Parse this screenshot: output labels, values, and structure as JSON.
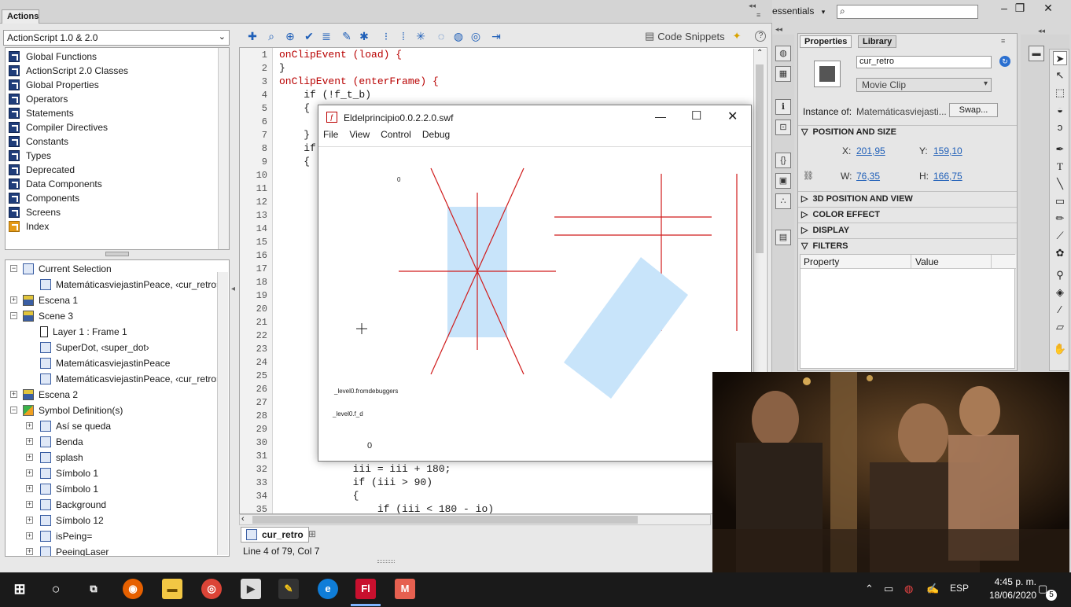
{
  "actions_panel": {
    "tab_label": "Actions",
    "language_select": "ActionScript 1.0 & 2.0",
    "library_items": [
      "Global Functions",
      "ActionScript 2.0 Classes",
      "Global Properties",
      "Operators",
      "Statements",
      "Compiler Directives",
      "Constants",
      "Types",
      "Deprecated",
      "Data Components",
      "Components",
      "Screens",
      "Index"
    ],
    "tree": [
      {
        "label": "Current Selection",
        "level": 0,
        "expander": "−",
        "icon": "script-icon"
      },
      {
        "label": "MatemáticasviejastinPeace, ‹cur_retro›",
        "level": 1,
        "expander": "",
        "icon": "movieclip-icon"
      },
      {
        "label": "Escena 1",
        "level": 0,
        "expander": "+",
        "icon": "scene-icon"
      },
      {
        "label": "Scene 3",
        "level": 0,
        "expander": "−",
        "icon": "scene-icon"
      },
      {
        "label": "Layer 1 : Frame 1",
        "level": 1,
        "expander": "",
        "icon": "frame-icon"
      },
      {
        "label": "SuperDot, ‹super_dot›",
        "level": 1,
        "expander": "",
        "icon": "movieclip-icon"
      },
      {
        "label": "MatemáticasviejastinPeace",
        "level": 1,
        "expander": "",
        "icon": "movieclip-icon"
      },
      {
        "label": "MatemáticasviejastinPeace, ‹cur_retro›",
        "level": 1,
        "expander": "",
        "icon": "movieclip-icon"
      },
      {
        "label": "Escena 2",
        "level": 0,
        "expander": "+",
        "icon": "scene-icon"
      },
      {
        "label": "Symbol Definition(s)",
        "level": 0,
        "expander": "−",
        "icon": "symbol-defs-icon"
      },
      {
        "label": "Así se queda",
        "level": 1,
        "expander": "+",
        "icon": "movieclip-icon"
      },
      {
        "label": "Benda",
        "level": 1,
        "expander": "+",
        "icon": "movieclip-icon"
      },
      {
        "label": "splash",
        "level": 1,
        "expander": "+",
        "icon": "movieclip-icon"
      },
      {
        "label": "Símbolo 1",
        "level": 1,
        "expander": "+",
        "icon": "movieclip-icon"
      },
      {
        "label": "Símbolo 1",
        "level": 1,
        "expander": "+",
        "icon": "movieclip-icon"
      },
      {
        "label": "Background",
        "level": 1,
        "expander": "+",
        "icon": "movieclip-icon"
      },
      {
        "label": "Símbolo 12",
        "level": 1,
        "expander": "+",
        "icon": "movieclip-icon"
      },
      {
        "label": "isPeing=",
        "level": 1,
        "expander": "+",
        "icon": "movieclip-icon"
      },
      {
        "label": "PeeingLaser",
        "level": 1,
        "expander": "+",
        "icon": "movieclip-icon"
      }
    ]
  },
  "editor": {
    "code_snippets_label": "Code Snippets",
    "line_numbers": [
      "1",
      "2",
      "3",
      "4",
      "5",
      "6",
      "7",
      "8",
      "9",
      "10",
      "11",
      "12",
      "13",
      "14",
      "15",
      "16",
      "17",
      "18",
      "19",
      "20",
      "21",
      "22",
      "23",
      "24",
      "25",
      "26",
      "27",
      "28",
      "29",
      "30",
      "31",
      "32",
      "33",
      "34",
      "35"
    ],
    "visible_code": [
      {
        "line": 1,
        "text": "onClipEvent (load) {"
      },
      {
        "line": 2,
        "text": "}"
      },
      {
        "line": 3,
        "text": "onClipEvent (enterFrame) {"
      },
      {
        "line": 4,
        "text": "    if (!f_t_b)"
      },
      {
        "line": 5,
        "text": "    {"
      },
      {
        "line": 7,
        "text": "    }"
      },
      {
        "line": 8,
        "text": "    if"
      },
      {
        "line": 9,
        "text": "    {"
      },
      {
        "line": 32,
        "text": "            iii = iii + 180;"
      },
      {
        "line": 33,
        "text": "            if (iii > 90)"
      },
      {
        "line": 34,
        "text": "            {"
      },
      {
        "line": 35,
        "text": "                if (iii < 180 - io)"
      }
    ],
    "script_tab": "cur_retro",
    "status": "Line 4 of 79, Col 7"
  },
  "topbar": {
    "workspace": "essentials",
    "search_placeholder": ""
  },
  "properties": {
    "tabs": [
      "Properties",
      "Library"
    ],
    "instance_name": "cur_retro",
    "symbol_type": "Movie Clip",
    "instance_of_label": "Instance of:",
    "instance_of_value": "Matemáticasviejasti...",
    "swap_label": "Swap...",
    "position_section": "POSITION AND SIZE",
    "x_label": "X:",
    "x_value": "201,95",
    "y_label": "Y:",
    "y_value": "159,10",
    "w_label": "W:",
    "w_value": "76,35",
    "h_label": "H:",
    "h_value": "166,75",
    "sections": [
      "3D POSITION AND VIEW",
      "COLOR EFFECT",
      "DISPLAY",
      "FILTERS"
    ],
    "filter_columns": [
      "Property",
      "Value"
    ]
  },
  "swf_window": {
    "title": "Eldelprincipio0.0.2.2.0.swf",
    "menu": [
      "File",
      "View",
      "Control",
      "Debug"
    ],
    "stage_labels": {
      "top_zero": "0",
      "debug1": "_level0.fromdebuggers",
      "debug2": "_level0.f_d",
      "bottom_zero": "0"
    }
  },
  "taskbar": {
    "language": "ESP",
    "time": "4:45 p. m.",
    "date": "18/06/2020",
    "notification_count": "5",
    "colors": {
      "flash_app": "#c8102e",
      "taskbar": "#1a1a1a"
    }
  }
}
